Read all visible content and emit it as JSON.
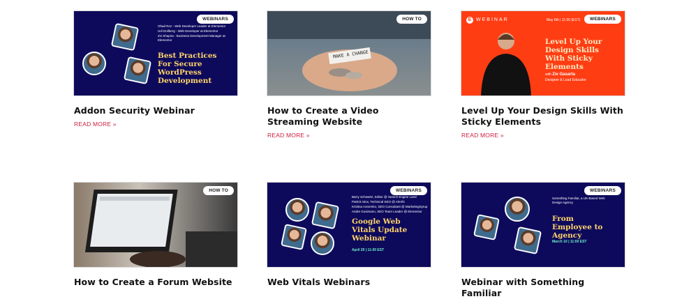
{
  "cards": [
    {
      "badge": "WEBINARS",
      "title": "Addon Security Webinar",
      "readmore": "READ MORE »",
      "promo": {
        "speakers": [
          "Ohad Roz - Web Developer Leader at Elementor",
          "Udi Dollberg - Web Developer at Elementor",
          "Zvi Shapira - Business Development Manager at Elementor"
        ],
        "headline": "Best Practices For Secure WordPress Development"
      }
    },
    {
      "badge": "HOW TO",
      "title": "How to Create a Video Streaming Website",
      "readmore": "READ MORE »",
      "photo_text": "MAKE A CHANGE"
    },
    {
      "badge": "WEBINARS",
      "title": "Level Up Your Design Skills With Sticky Elements",
      "readmore": "READ MORE »",
      "promo": {
        "brand": "WEBINAR",
        "date": "May 6th | 11:00 (EST)",
        "headline": "Level Up Your Design Skills With Sticky Elements",
        "host_prefix": "with",
        "host": "Ziv Gasarta",
        "host_role": "Designer & Lead Educator"
      }
    },
    {
      "badge": "HOW TO",
      "title": "How to Create a Forum Website"
    },
    {
      "badge": "WEBINARS",
      "title": "Web Vitals Webinars",
      "promo": {
        "speakers": [
          "Barry Schwartz, Editor @ Search Engine Land",
          "Patrick Stox, Technical SEO @ Ahrefs",
          "Kristina Azarenko, SEO Consultant @ MarketingSyrup",
          "Andre Gusimano, SEO Team Leader @ Elementor"
        ],
        "headline": "Google Web Vitals Update Webinar",
        "date": "April 29 | 11:00 EST"
      }
    },
    {
      "badge": "WEBINARS",
      "title": "Webinar with Something Familiar",
      "promo": {
        "org": "Something Familiar, a UK-Based Web Design Agency",
        "headline": "From Employee to Agency",
        "date": "March 10 | 11:00 EST"
      }
    }
  ]
}
